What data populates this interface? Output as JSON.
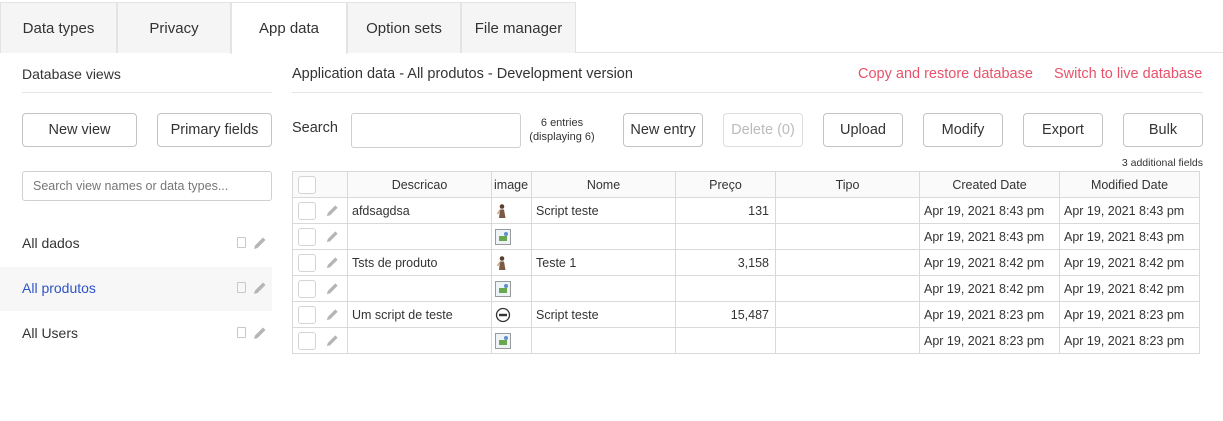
{
  "tabs": [
    "Data types",
    "Privacy",
    "App data",
    "Option sets",
    "File manager"
  ],
  "active_tab": 2,
  "left": {
    "title": "Database views",
    "new_view_label": "New view",
    "primary_fields_label": "Primary fields",
    "search_placeholder": "Search view names or data types...",
    "views": [
      {
        "label": "All dados",
        "selected": false
      },
      {
        "label": "All produtos",
        "selected": true
      },
      {
        "label": "All Users",
        "selected": false
      }
    ]
  },
  "header": {
    "title": "Application data - All produtos - Development version",
    "copy_restore_label": "Copy and restore database",
    "switch_live_label": "Switch to live database",
    "link_color": "#e8526a"
  },
  "toolbar": {
    "search_label": "Search",
    "search_value": "",
    "entries_count": "6 entries",
    "entries_display": "(displaying 6)",
    "new_entry_label": "New entry",
    "delete_label": "Delete (0)",
    "upload_label": "Upload",
    "modify_label": "Modify",
    "export_label": "Export",
    "bulk_label": "Bulk",
    "additional_fields": "3 additional fields"
  },
  "table": {
    "columns": [
      "Descricao",
      "image",
      "Nome",
      "Preço",
      "Tipo",
      "Created Date",
      "Modified Date"
    ],
    "rows": [
      {
        "descricao": "afdsagdsa",
        "image": "figure-thumb",
        "nome": "Script teste",
        "preco": "131",
        "tipo": "",
        "created": "Apr 19, 2021 8:43 pm",
        "modified": "Apr 19, 2021 8:43 pm"
      },
      {
        "descricao": "",
        "image": "broken-image-icon",
        "nome": "",
        "preco": "",
        "tipo": "",
        "created": "Apr 19, 2021 8:43 pm",
        "modified": "Apr 19, 2021 8:43 pm"
      },
      {
        "descricao": "Tsts de produto",
        "image": "figure-thumb",
        "nome": "Teste 1",
        "preco": "3,158",
        "tipo": "",
        "created": "Apr 19, 2021 8:42 pm",
        "modified": "Apr 19, 2021 8:42 pm"
      },
      {
        "descricao": "",
        "image": "broken-image-icon",
        "nome": "",
        "preco": "",
        "tipo": "",
        "created": "Apr 19, 2021 8:42 pm",
        "modified": "Apr 19, 2021 8:42 pm"
      },
      {
        "descricao": "Um script de teste",
        "image": "logo-thumb",
        "nome": "Script teste",
        "preco": "15,487",
        "tipo": "",
        "created": "Apr 19, 2021 8:23 pm",
        "modified": "Apr 19, 2021 8:23 pm"
      },
      {
        "descricao": "",
        "image": "broken-image-icon",
        "nome": "",
        "preco": "",
        "tipo": "",
        "created": "Apr 19, 2021 8:23 pm",
        "modified": "Apr 19, 2021 8:23 pm"
      }
    ]
  }
}
